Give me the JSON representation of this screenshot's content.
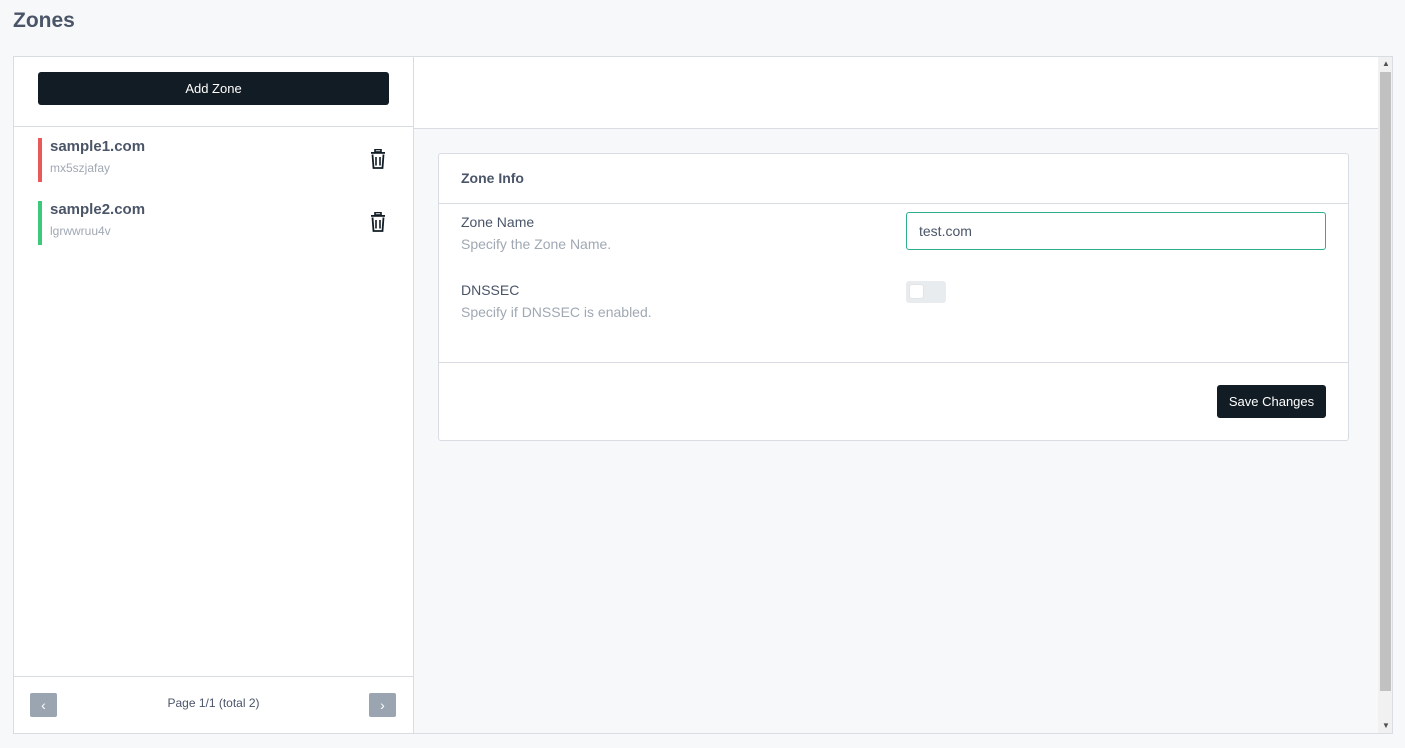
{
  "page": {
    "title": "Zones"
  },
  "sidebar": {
    "add_zone_label": "Add Zone",
    "zones": [
      {
        "name": "sample1.com",
        "id": "mx5szjafay",
        "status_color": "#e85a5a"
      },
      {
        "name": "sample2.com",
        "id": "lgrwwruu4v",
        "status_color": "#3ec97a"
      }
    ],
    "pager": {
      "prev_icon": "chevron-left-icon",
      "next_icon": "chevron-right-icon",
      "text": "Page 1/1 (total 2)"
    }
  },
  "zone_info": {
    "title": "Zone Info",
    "zone_name": {
      "label": "Zone Name",
      "help": "Specify the Zone Name.",
      "value": "test.com"
    },
    "dnssec": {
      "label": "DNSSEC",
      "help": "Specify if DNSSEC is enabled.",
      "enabled": false
    },
    "save_label": "Save Changes"
  },
  "colors": {
    "primary_button": "#111c24",
    "input_focus_border": "#2fae8f",
    "muted_text": "#a0a8b3"
  }
}
